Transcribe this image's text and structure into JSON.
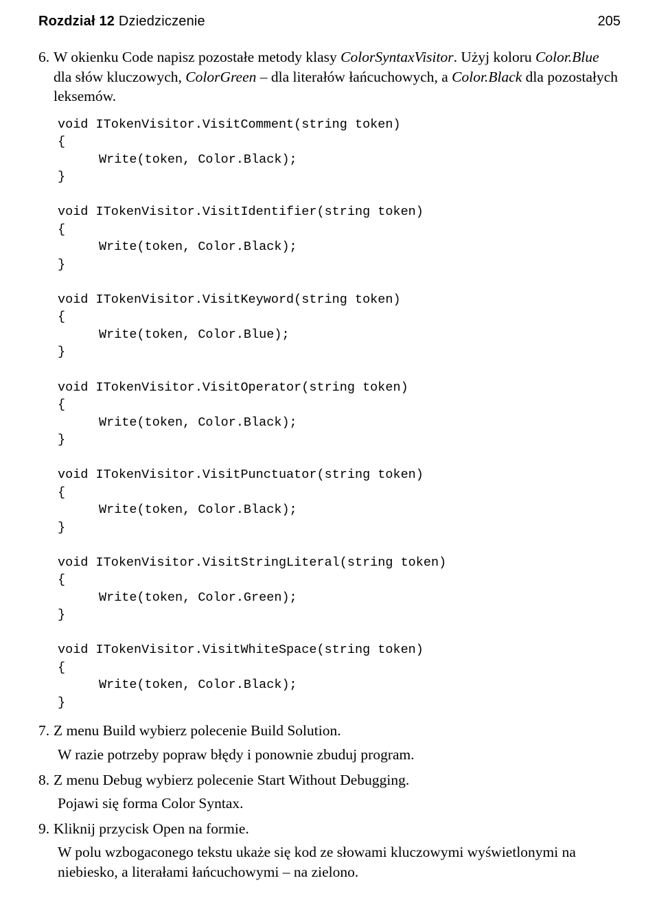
{
  "header": {
    "chapter_label": "Rozdział 12",
    "chapter_title": "Dziedziczenie",
    "page_number": "205"
  },
  "steps": {
    "s6": {
      "num": "6.",
      "text_parts": {
        "p1": "W okienku Code napisz pozostałe metody klasy ",
        "class1": "ColorSyntaxVisitor",
        "p2": ". Użyj koloru ",
        "color1": "Color.Blue",
        "p3": " dla słów kluczowych, ",
        "color2": "ColorGreen",
        "p4": " – dla literałów łańcuchowych, a ",
        "color3": "Color.Black",
        "p5": " dla pozostałych leksemów."
      }
    },
    "code": {
      "l1": "void ITokenVisitor.VisitComment(string token)",
      "l2": "{",
      "l3": "Write(token, Color.Black);",
      "l4": "}",
      "l5": "",
      "l6": "void ITokenVisitor.VisitIdentifier(string token)",
      "l7": "{",
      "l8": "Write(token, Color.Black);",
      "l9": "}",
      "l10": "",
      "l11": "void ITokenVisitor.VisitKeyword(string token)",
      "l12": "{",
      "l13": "Write(token, Color.Blue);",
      "l14": "}",
      "l15": "",
      "l16": "void ITokenVisitor.VisitOperator(string token)",
      "l17": "{",
      "l18": "Write(token, Color.Black);",
      "l19": "}",
      "l20": "",
      "l21": "void ITokenVisitor.VisitPunctuator(string token)",
      "l22": "{",
      "l23": "Write(token, Color.Black);",
      "l24": "}",
      "l25": "",
      "l26": "void ITokenVisitor.VisitStringLiteral(string token)",
      "l27": "{",
      "l28": "Write(token, Color.Green);",
      "l29": "}",
      "l30": "",
      "l31": "void ITokenVisitor.VisitWhiteSpace(string token)",
      "l32": "{",
      "l33": "Write(token, Color.Black);",
      "l34": "}"
    },
    "s7": {
      "num": "7.",
      "line1": "Z menu Build wybierz polecenie Build Solution.",
      "line2": "W razie potrzeby popraw błędy i ponownie zbuduj program."
    },
    "s8": {
      "num": "8.",
      "line1": "Z menu Debug wybierz polecenie Start Without Debugging.",
      "line2": "Pojawi się forma Color Syntax."
    },
    "s9": {
      "num": "9.",
      "line1": "Kliknij przycisk Open na formie.",
      "line2": "W polu wzbogaconego tekstu ukaże się kod ze słowami kluczowymi wyświetlonymi na niebiesko, a literałami łańcuchowymi – na zielono."
    }
  }
}
